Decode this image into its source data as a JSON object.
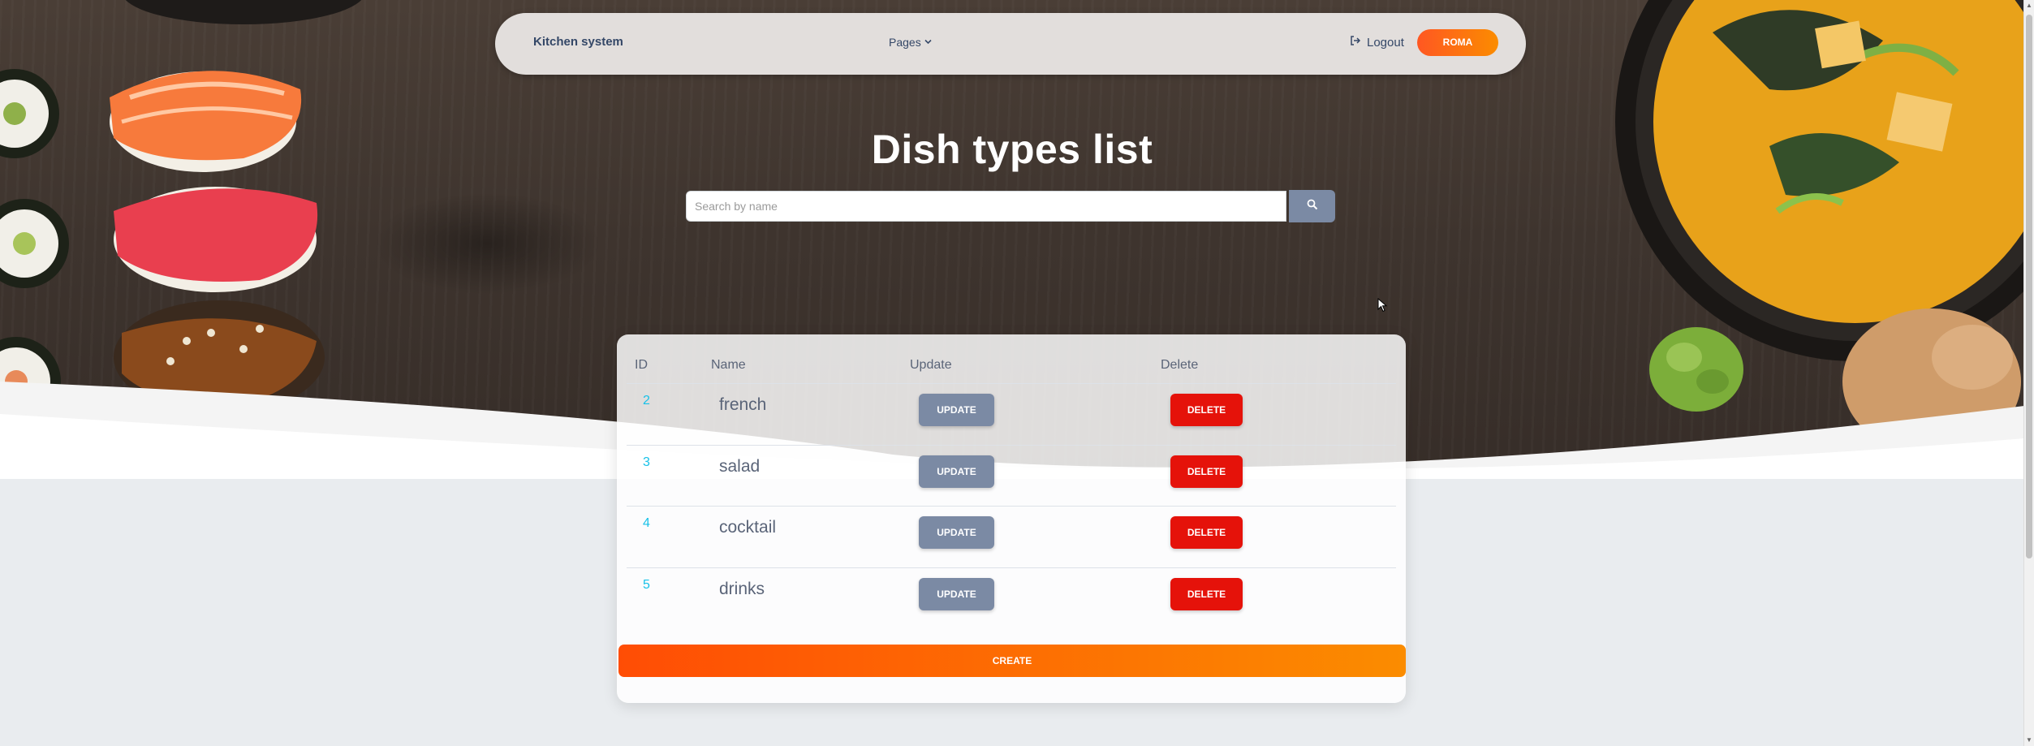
{
  "navbar": {
    "brand": "Kitchen system",
    "pages_label": "Pages",
    "logout_label": "Logout",
    "user_label": "ROMA"
  },
  "page_title": "Dish types list",
  "search": {
    "placeholder": "Search by name",
    "value": ""
  },
  "table": {
    "headers": {
      "id": "ID",
      "name": "Name",
      "update": "Update",
      "delete": "Delete"
    },
    "rows": [
      {
        "id": "2",
        "name": "french",
        "update_label": "UPDATE",
        "delete_label": "DELETE"
      },
      {
        "id": "3",
        "name": "salad",
        "update_label": "UPDATE",
        "delete_label": "DELETE"
      },
      {
        "id": "4",
        "name": "cocktail",
        "update_label": "UPDATE",
        "delete_label": "DELETE"
      },
      {
        "id": "5",
        "name": "drinks",
        "update_label": "UPDATE",
        "delete_label": "DELETE"
      }
    ],
    "create_label": "CREATE"
  },
  "icons": {
    "logout": "logout-icon",
    "pages_chevron": "chevron-down-icon",
    "search": "search-icon"
  },
  "colors": {
    "accent_orange": "#fb8c00",
    "delete_red": "#e5120a",
    "update_slate": "#7b8aa4",
    "id_cyan": "#17c1e8"
  }
}
